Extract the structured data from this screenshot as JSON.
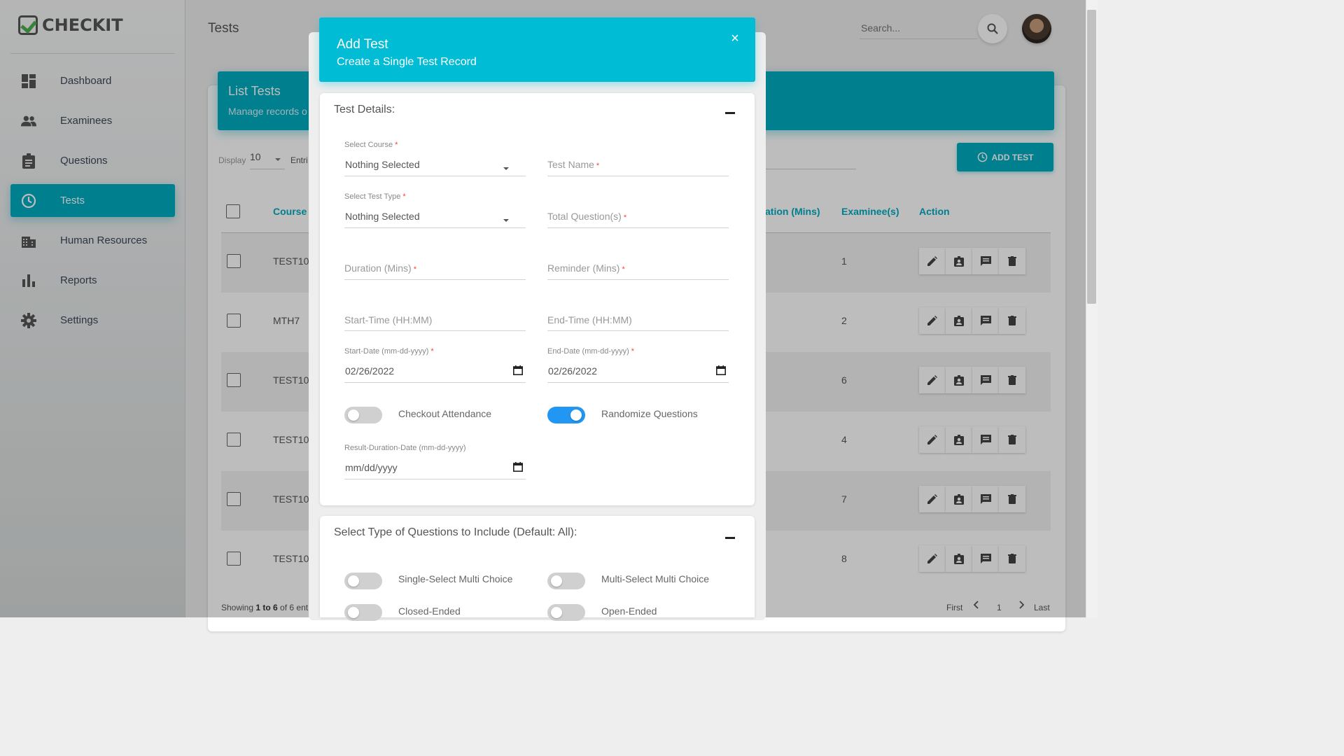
{
  "app": {
    "logo_text": "CHECKIT"
  },
  "sidebar": {
    "items": [
      {
        "label": "Dashboard",
        "icon": "dashboard-icon"
      },
      {
        "label": "Examinees",
        "icon": "people-icon"
      },
      {
        "label": "Questions",
        "icon": "clipboard-icon"
      },
      {
        "label": "Tests",
        "icon": "clock-icon",
        "active": true
      },
      {
        "label": "Human Resources",
        "icon": "building-icon"
      },
      {
        "label": "Reports",
        "icon": "bar-chart-icon"
      },
      {
        "label": "Settings",
        "icon": "gear-icon"
      }
    ]
  },
  "header": {
    "page_title": "Tests",
    "search_placeholder": "Search..."
  },
  "list_card": {
    "title": "List Tests",
    "subtitle": "Manage records o",
    "display_label": "Display",
    "display_value": "10",
    "entries_label": "Entri",
    "add_button": "ADD TEST",
    "columns": {
      "course": "Course",
      "duration": "ation (Mins)",
      "examinees": "Examinee(s)",
      "action": "Action"
    },
    "rows": [
      {
        "course": "TEST10",
        "examinees": "1"
      },
      {
        "course": "MTH7",
        "examinees": "2"
      },
      {
        "course": "TEST10",
        "examinees": "6"
      },
      {
        "course": "TEST10",
        "examinees": "4"
      },
      {
        "course": "TEST10",
        "examinees": "7"
      },
      {
        "course": "TEST10",
        "examinees": "8"
      }
    ],
    "showing": {
      "prefix": "Showing ",
      "range": "1 to 6",
      "suffix": " of 6 ent"
    },
    "pager": {
      "first": "First",
      "page": "1",
      "last": "Last"
    }
  },
  "modal": {
    "title": "Add Test",
    "subtitle": "Create a Single Test Record",
    "close": "×",
    "details": {
      "title": "Test Details:",
      "course_label": "Select Course",
      "course_value": "Nothing Selected",
      "test_name_placeholder": "Test Name",
      "type_label": "Select Test Type",
      "type_value": "Nothing Selected",
      "total_questions_placeholder": "Total Question(s)",
      "duration_placeholder": "Duration (Mins)",
      "reminder_placeholder": "Reminder (Mins)",
      "start_time_placeholder": "Start-Time (HH:MM)",
      "end_time_placeholder": "End-Time (HH:MM)",
      "start_date_label": "Start-Date (mm-dd-yyyy)",
      "start_date_value": "02/26/2022",
      "end_date_label": "End-Date (mm-dd-yyyy)",
      "end_date_value": "02/26/2022",
      "checkout_label": "Checkout Attendance",
      "checkout_on": false,
      "randomize_label": "Randomize Questions",
      "randomize_on": true,
      "result_date_label": "Result-Duration-Date (mm-dd-yyyy)",
      "result_date_value": "mm/dd/yyyy",
      "required_mark": "*"
    },
    "question_types": {
      "title": "Select Type of Questions to Include (Default: All):",
      "options": [
        {
          "label": "Single-Select Multi Choice",
          "on": false
        },
        {
          "label": "Multi-Select Multi Choice",
          "on": false
        },
        {
          "label": "Closed-Ended",
          "on": false
        },
        {
          "label": "Open-Ended",
          "on": false
        }
      ]
    }
  },
  "colors": {
    "accent": "#00acc1",
    "modal_header": "#00bcd4",
    "toggle_on": "#2196f3",
    "required": "#f44336"
  }
}
